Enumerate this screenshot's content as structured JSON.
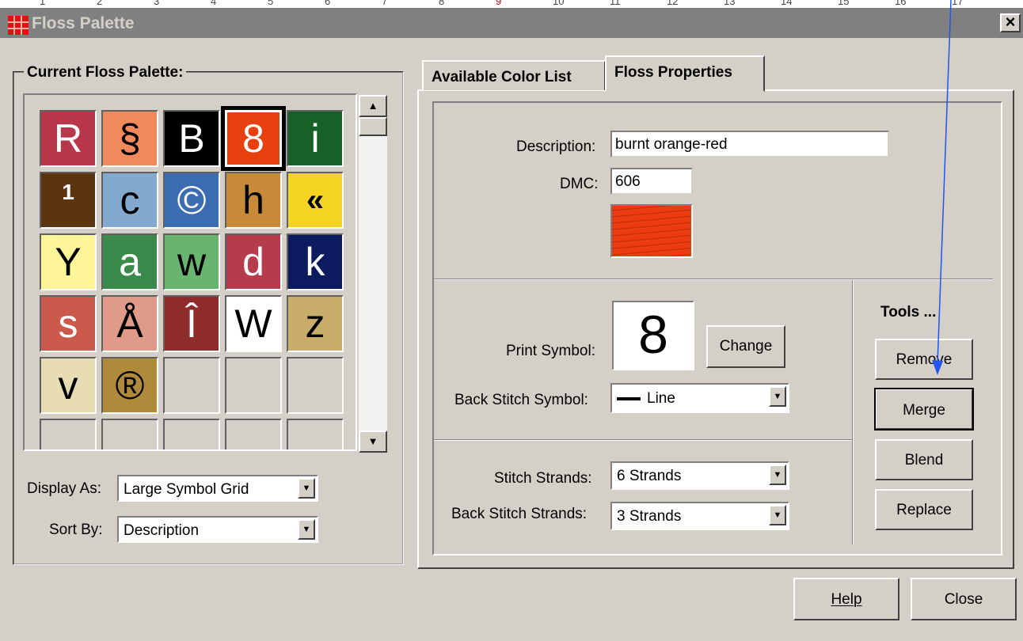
{
  "ruler": {
    "marks": [
      "1",
      "2",
      "3",
      "4",
      "5",
      "6",
      "7",
      "8",
      "9",
      "10",
      "11",
      "12",
      "13",
      "14",
      "15",
      "16",
      "17"
    ]
  },
  "window": {
    "title": "Floss Palette",
    "close_label": "×"
  },
  "palette": {
    "title": "Current Floss Palette:",
    "cells": [
      {
        "symbol": "R",
        "bg": "#b8374a",
        "fg": "#ffffff"
      },
      {
        "symbol": "§",
        "bg": "#f08a5d",
        "fg": "#000000"
      },
      {
        "symbol": "B",
        "bg": "#000000",
        "fg": "#ffffff"
      },
      {
        "symbol": "8",
        "bg": "#e8400e",
        "fg": "#ffffff",
        "selected": true
      },
      {
        "symbol": "i",
        "bg": "#156127",
        "fg": "#ffffff"
      },
      {
        "symbol": "1",
        "bg": "#5b3410",
        "fg": "#ffffff"
      },
      {
        "symbol": "c",
        "bg": "#84a9cf",
        "fg": "#000000"
      },
      {
        "symbol": "©",
        "bg": "#3c6db0",
        "fg": "#ffffff"
      },
      {
        "symbol": "h",
        "bg": "#c78a38",
        "fg": "#000000"
      },
      {
        "symbol": "«",
        "bg": "#f4d422",
        "fg": "#000000"
      },
      {
        "symbol": "Y",
        "bg": "#fdf598",
        "fg": "#000000"
      },
      {
        "symbol": "a",
        "bg": "#3a8a4c",
        "fg": "#ffffff"
      },
      {
        "symbol": "w",
        "bg": "#69b56f",
        "fg": "#000000"
      },
      {
        "symbol": "d",
        "bg": "#b63c4c",
        "fg": "#ffffff"
      },
      {
        "symbol": "k",
        "bg": "#0c1a60",
        "fg": "#ffffff"
      },
      {
        "symbol": "s",
        "bg": "#cc5a4c",
        "fg": "#ffffff"
      },
      {
        "symbol": "Å",
        "bg": "#e09a8a",
        "fg": "#000000"
      },
      {
        "symbol": "Î",
        "bg": "#8e2c2c",
        "fg": "#ffffff"
      },
      {
        "symbol": "W",
        "bg": "#ffffff",
        "fg": "#000000"
      },
      {
        "symbol": "z",
        "bg": "#c9ad6a",
        "fg": "#000000"
      },
      {
        "symbol": "v",
        "bg": "#e8dcb2",
        "fg": "#000000"
      },
      {
        "symbol": "®",
        "bg": "#b08a3a",
        "fg": "#000000"
      },
      {
        "symbol": "",
        "bg": "",
        "fg": ""
      },
      {
        "symbol": "",
        "bg": "",
        "fg": ""
      },
      {
        "symbol": "",
        "bg": "",
        "fg": ""
      },
      {
        "symbol": "",
        "bg": "",
        "fg": ""
      },
      {
        "symbol": "",
        "bg": "",
        "fg": ""
      },
      {
        "symbol": "",
        "bg": "",
        "fg": ""
      },
      {
        "symbol": "",
        "bg": "",
        "fg": ""
      },
      {
        "symbol": "",
        "bg": "",
        "fg": ""
      }
    ],
    "display_as_label": "Display As:",
    "display_as_value": "Large Symbol Grid",
    "sort_by_label": "Sort By:",
    "sort_by_value": "Description"
  },
  "tabs": [
    {
      "label": "Available Color List",
      "active": false
    },
    {
      "label": "Floss Properties",
      "active": true
    }
  ],
  "properties": {
    "description_label": "Description:",
    "description_value": "burnt orange-red",
    "dmc_label": "DMC:",
    "dmc_value": "606",
    "swatch_color": "#ec3b0e",
    "print_symbol_label": "Print Symbol:",
    "print_symbol_value": "8",
    "change_label": "Change",
    "back_stitch_symbol_label": "Back Stitch Symbol:",
    "back_stitch_symbol_value": "Line",
    "stitch_strands_label": "Stitch Strands:",
    "stitch_strands_value": "6 Strands",
    "back_stitch_strands_label": "Back Stitch Strands:",
    "back_stitch_strands_value": "3 Strands"
  },
  "tools": {
    "title": "Tools ...",
    "remove": "Remove",
    "merge": "Merge",
    "blend": "Blend",
    "replace": "Replace"
  },
  "footer": {
    "help_label": "Help",
    "close_label": "Close"
  },
  "annotation_arrow_color": "#2255ee"
}
